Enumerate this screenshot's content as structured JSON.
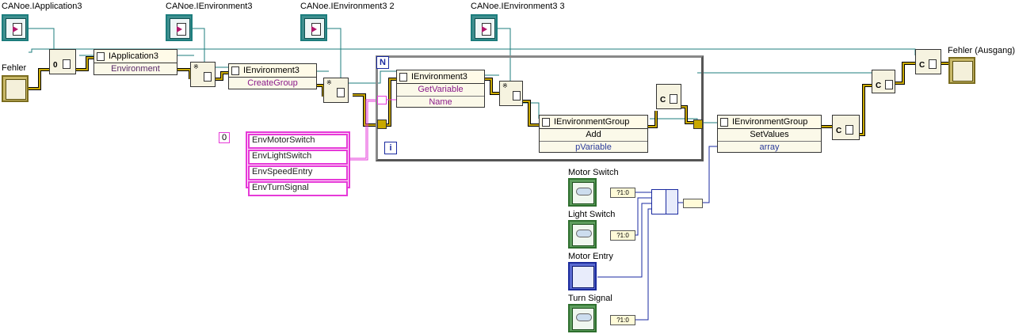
{
  "labels": {
    "app_ref": "CANoe.IApplication3",
    "env_ref1": "CANoe.IEnvironment3",
    "env_ref2": "CANoe.IEnvironment3 2",
    "env_ref3": "CANoe.IEnvironment3 3",
    "error_in": "Fehler",
    "error_out": "Fehler (Ausgang)",
    "motor_switch": "Motor Switch",
    "light_switch": "Light Switch",
    "motor_entry": "Motor Entry",
    "turn_signal": "Turn Signal"
  },
  "nodes": {
    "app_node": {
      "class": "IApplication3",
      "prop": "Environment"
    },
    "env_node1": {
      "class": "IEnvironment3",
      "method": "CreateGroup"
    },
    "env_node2": {
      "class": "IEnvironment3",
      "method": "GetVariable",
      "param": "Name"
    },
    "group_add": {
      "class": "IEnvironmentGroup",
      "method": "Add",
      "param": "pVariable"
    },
    "group_set": {
      "class": "IEnvironmentGroup",
      "method": "SetValues",
      "param": "array"
    }
  },
  "loop": {
    "count_label": "N",
    "iter_label": "i"
  },
  "string_array": {
    "index": "0",
    "items": [
      "EnvMotorSwitch",
      "EnvLightSwitch",
      "EnvSpeedEntry",
      "EnvTurnSignal"
    ]
  },
  "converters": {
    "bool_to_num": "?1:0"
  },
  "colors": {
    "refnum": "#1c7d7d",
    "error_wire": "#c8a800",
    "string_wire": "#e63ad8",
    "numeric_wire": "#1a2aa0"
  }
}
